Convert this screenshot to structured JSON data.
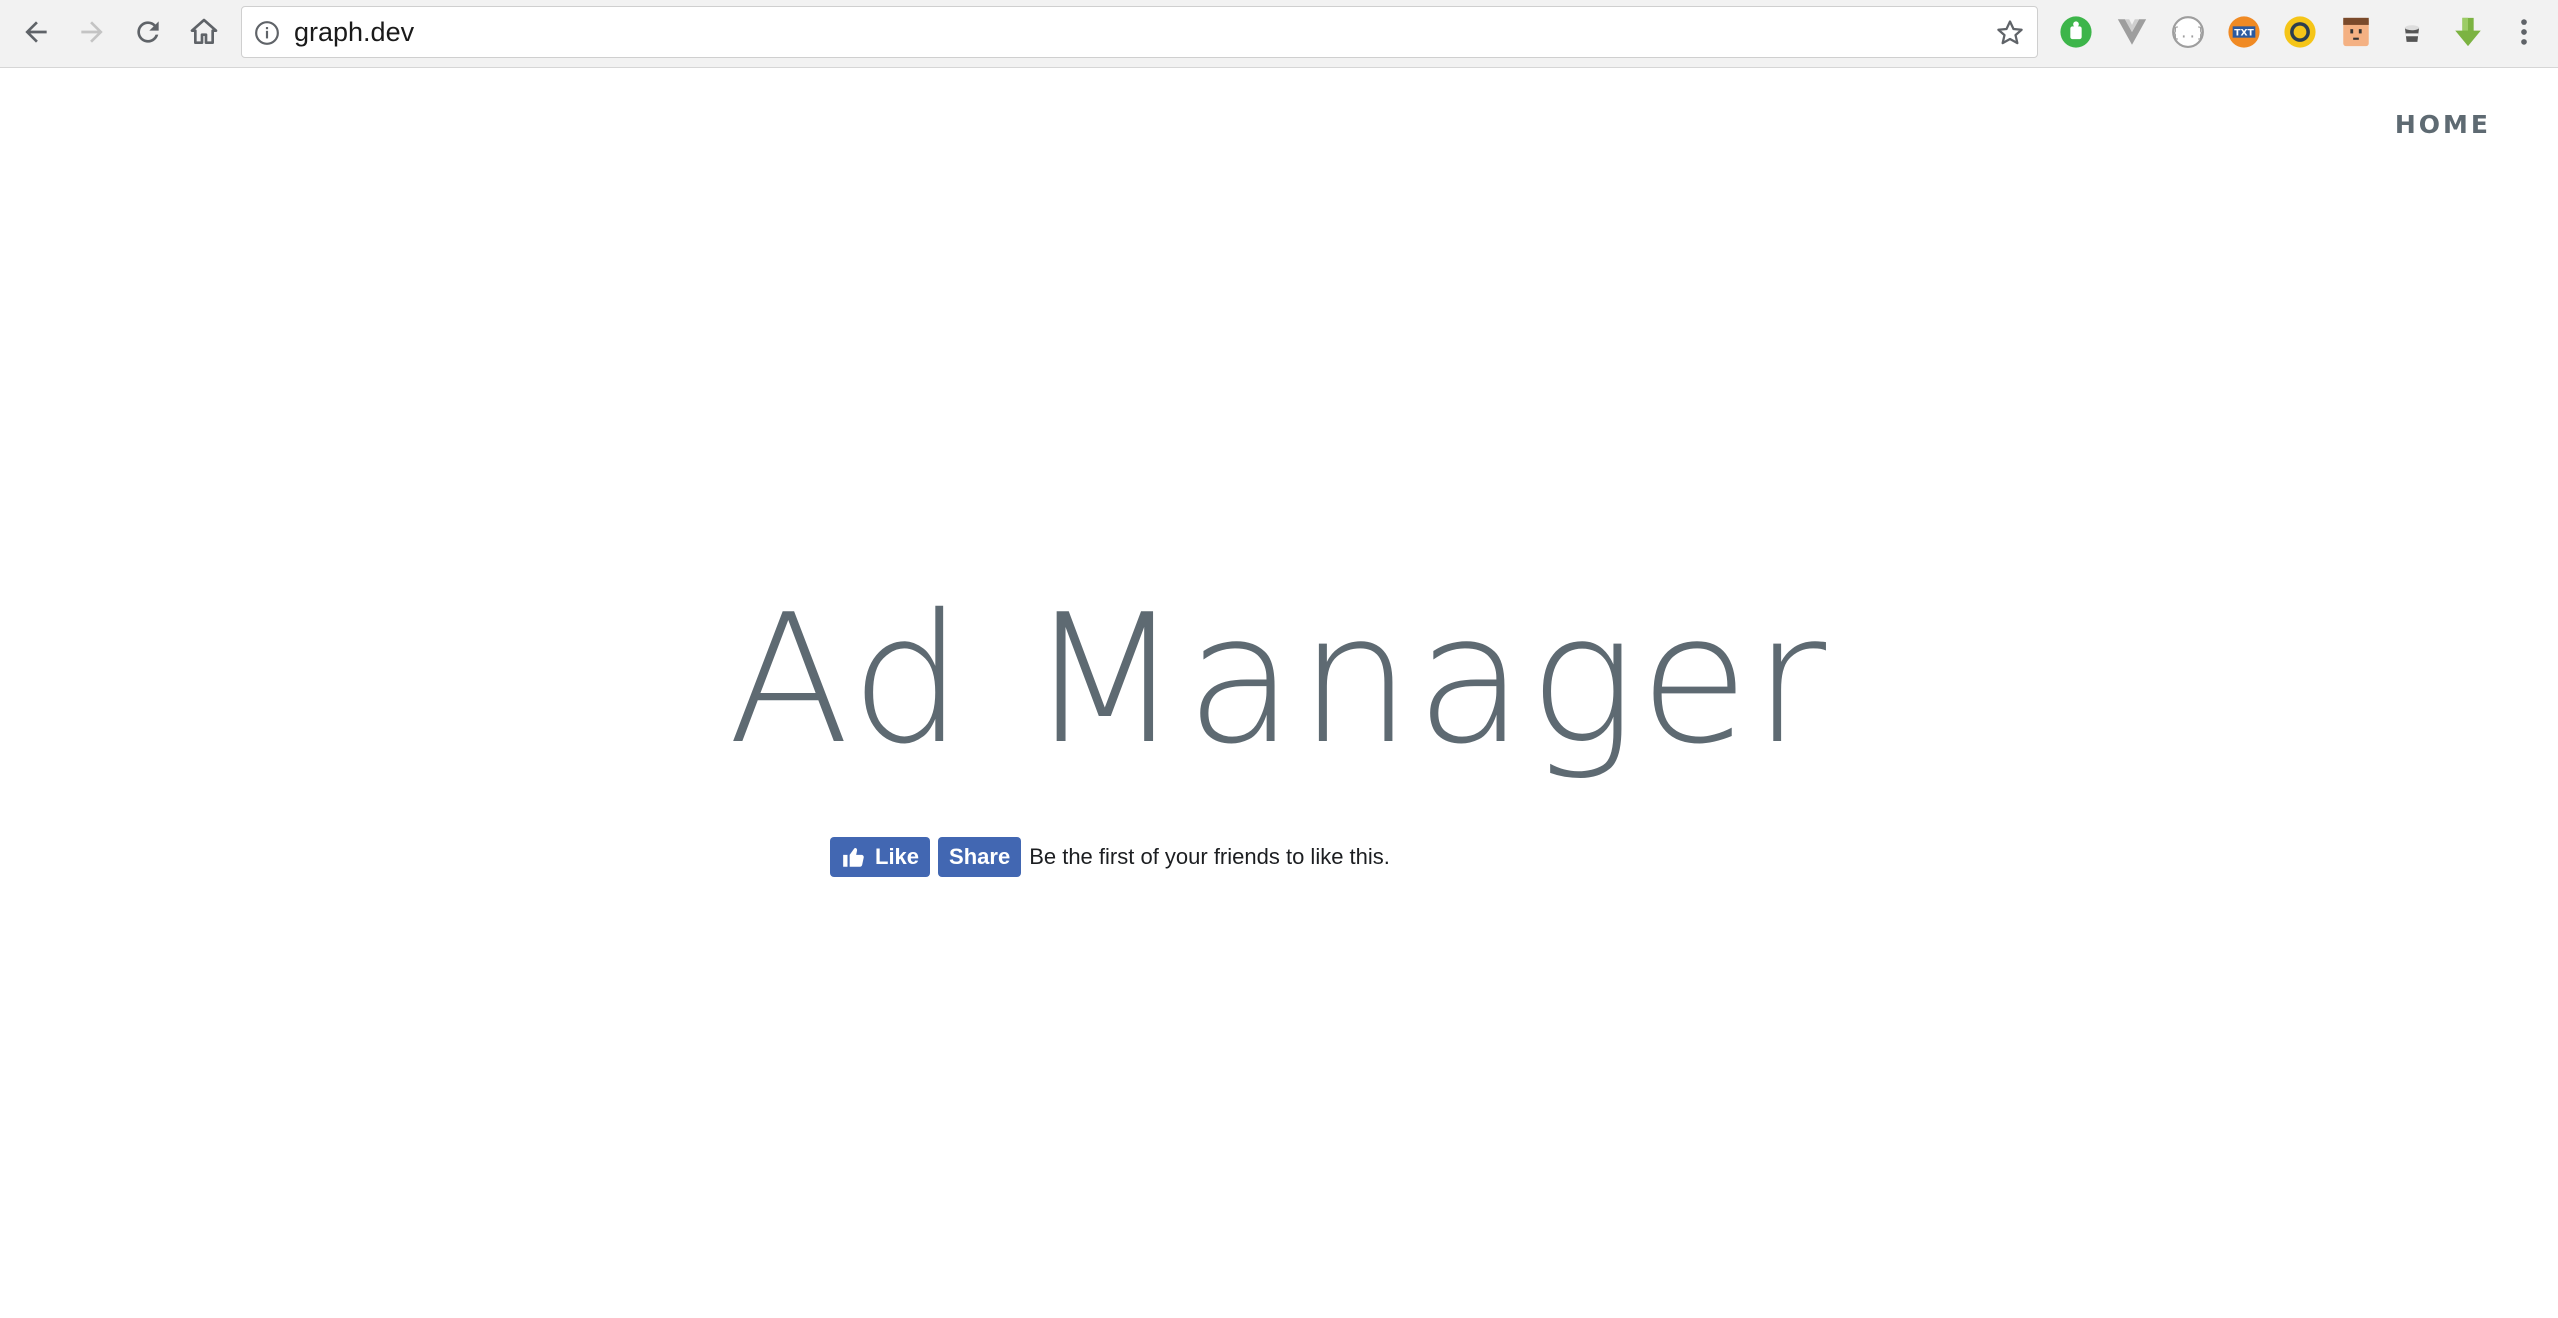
{
  "browser": {
    "url": "graph.dev",
    "icons": {
      "back": "back-arrow-icon",
      "forward": "forward-arrow-icon",
      "reload": "reload-icon",
      "home": "home-icon",
      "info": "info-icon",
      "bookmark": "star-icon",
      "menu": "kebab-menu-icon"
    },
    "extensions": [
      "green-puzzle-extension-icon",
      "vue-devtools-icon",
      "json-viewer-icon",
      "txt-globe-extension-icon",
      "yellow-ring-extension-icon",
      "face-extension-icon",
      "coffee-cup-extension-icon",
      "green-download-arrow-icon"
    ]
  },
  "page": {
    "nav": {
      "home_label": "HOME"
    },
    "hero": {
      "title": "Ad Manager"
    },
    "social": {
      "like_label": "Like",
      "share_label": "Share",
      "text": "Be the first of your friends to like this.",
      "color": "#4267b2"
    }
  }
}
